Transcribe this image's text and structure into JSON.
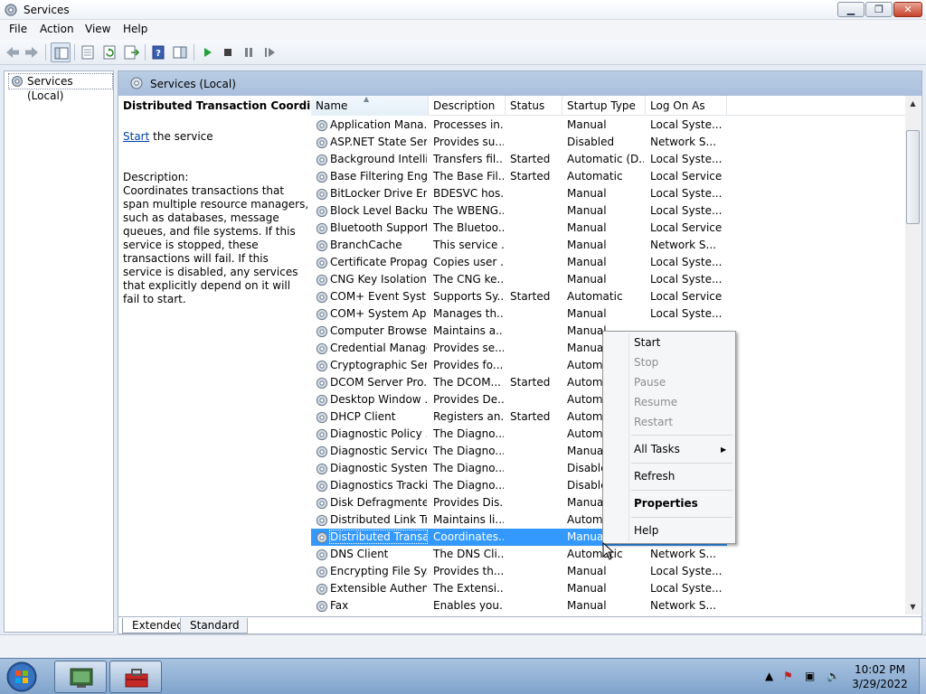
{
  "window": {
    "title": "Services"
  },
  "menu": [
    "File",
    "Action",
    "View",
    "Help"
  ],
  "tree": {
    "root": "Services (Local)"
  },
  "pane_header": "Services (Local)",
  "details": {
    "service_name": "Distributed Transaction Coordinator",
    "start_link": "Start",
    "start_suffix": " the service",
    "description_label": "Description:",
    "description_text": "Coordinates transactions that span multiple resource managers, such as databases, message queues, and file systems. If this service is stopped, these transactions will fail. If this service is disabled, any services that explicitly depend on it will fail to start."
  },
  "columns": [
    "Name",
    "Description",
    "Status",
    "Startup Type",
    "Log On As"
  ],
  "services": [
    {
      "name": "Application Mana...",
      "description": "Processes in...",
      "status": "",
      "startup": "Manual",
      "logon": "Local Syste..."
    },
    {
      "name": "ASP.NET State Ser...",
      "description": "Provides su...",
      "status": "",
      "startup": "Disabled",
      "logon": "Network S..."
    },
    {
      "name": "Background Intelli...",
      "description": "Transfers fil...",
      "status": "Started",
      "startup": "Automatic (D...",
      "logon": "Local Syste..."
    },
    {
      "name": "Base Filtering Engi...",
      "description": "The Base Fil...",
      "status": "Started",
      "startup": "Automatic",
      "logon": "Local Service"
    },
    {
      "name": "BitLocker Drive En...",
      "description": "BDESVC hos...",
      "status": "",
      "startup": "Manual",
      "logon": "Local Syste..."
    },
    {
      "name": "Block Level Backu...",
      "description": "The WBENG...",
      "status": "",
      "startup": "Manual",
      "logon": "Local Syste..."
    },
    {
      "name": "Bluetooth Support...",
      "description": "The Bluetoo...",
      "status": "",
      "startup": "Manual",
      "logon": "Local Service"
    },
    {
      "name": "BranchCache",
      "description": "This service ...",
      "status": "",
      "startup": "Manual",
      "logon": "Network S..."
    },
    {
      "name": "Certificate Propag...",
      "description": "Copies user ...",
      "status": "",
      "startup": "Manual",
      "logon": "Local Syste..."
    },
    {
      "name": "CNG Key Isolation",
      "description": "The CNG ke...",
      "status": "",
      "startup": "Manual",
      "logon": "Local Syste..."
    },
    {
      "name": "COM+ Event Syst...",
      "description": "Supports Sy...",
      "status": "Started",
      "startup": "Automatic",
      "logon": "Local Service"
    },
    {
      "name": "COM+ System Ap...",
      "description": "Manages th...",
      "status": "",
      "startup": "Manual",
      "logon": "Local Syste..."
    },
    {
      "name": "Computer Browser",
      "description": "Maintains a...",
      "status": "",
      "startup": "Manual",
      "logon": ""
    },
    {
      "name": "Credential Manager",
      "description": "Provides se...",
      "status": "",
      "startup": "Manual",
      "logon": ""
    },
    {
      "name": "Cryptographic Ser...",
      "description": "Provides fo...",
      "status": "",
      "startup": "Automa",
      "logon": ""
    },
    {
      "name": "DCOM Server Pro...",
      "description": "The DCOM...",
      "status": "Started",
      "startup": "Automa",
      "logon": ""
    },
    {
      "name": "Desktop Window ...",
      "description": "Provides De...",
      "status": "",
      "startup": "Automa",
      "logon": ""
    },
    {
      "name": "DHCP Client",
      "description": "Registers an...",
      "status": "Started",
      "startup": "Automa",
      "logon": ""
    },
    {
      "name": "Diagnostic Policy ...",
      "description": "The Diagno...",
      "status": "",
      "startup": "Automa",
      "logon": ""
    },
    {
      "name": "Diagnostic Service...",
      "description": "The Diagno...",
      "status": "",
      "startup": "Manual",
      "logon": ""
    },
    {
      "name": "Diagnostic System...",
      "description": "The Diagno...",
      "status": "",
      "startup": "Disable",
      "logon": ""
    },
    {
      "name": "Diagnostics Tracki...",
      "description": "The Diagno...",
      "status": "",
      "startup": "Disable",
      "logon": ""
    },
    {
      "name": "Disk Defragmenter",
      "description": "Provides Dis...",
      "status": "",
      "startup": "Manual",
      "logon": ""
    },
    {
      "name": "Distributed Link Tr...",
      "description": "Maintains li...",
      "status": "",
      "startup": "Automa",
      "logon": ""
    },
    {
      "name": "Distributed Transa...",
      "description": "Coordinates...",
      "status": "",
      "startup": "Manual",
      "logon": "",
      "selected": true
    },
    {
      "name": "DNS Client",
      "description": "The DNS Cli...",
      "status": "",
      "startup": "Automatic",
      "logon": "Network S..."
    },
    {
      "name": "Encrypting File Sy...",
      "description": "Provides th...",
      "status": "",
      "startup": "Manual",
      "logon": "Local Syste..."
    },
    {
      "name": "Extensible Authen...",
      "description": "The Extensi...",
      "status": "",
      "startup": "Manual",
      "logon": "Local Syste..."
    },
    {
      "name": "Fax",
      "description": "Enables you...",
      "status": "",
      "startup": "Manual",
      "logon": "Network S..."
    }
  ],
  "context_menu": {
    "start": "Start",
    "stop": "Stop",
    "pause": "Pause",
    "resume": "Resume",
    "restart": "Restart",
    "all_tasks": "All Tasks",
    "refresh": "Refresh",
    "properties": "Properties",
    "help": "Help"
  },
  "tabs": [
    "Extended",
    "Standard"
  ],
  "clock": {
    "time": "10:02 PM",
    "date": "3/29/2022"
  },
  "colors": {
    "selection": "#3399ff",
    "pane_header": "#b9cde4",
    "taskbar": "#8fb0d8"
  }
}
